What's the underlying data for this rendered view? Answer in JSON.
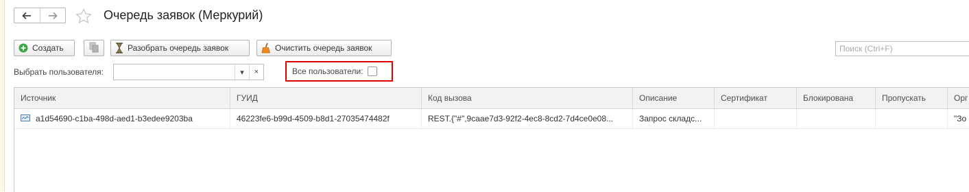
{
  "nav": {
    "back_icon": "arrow-left-icon",
    "forward_icon": "arrow-right-icon"
  },
  "favorite_icon": "star-icon",
  "title": "Очередь заявок (Меркурий)",
  "toolbar": {
    "create_label": "Создать",
    "create_icon": "plus-circle-icon",
    "copy_icon": "copy-icon",
    "parse_label": "Разобрать очередь заявок",
    "parse_icon": "hourglass-icon",
    "clear_label": "Очистить очередь заявок",
    "clear_icon": "broom-icon"
  },
  "search": {
    "placeholder": "Поиск (Ctrl+F)",
    "value": ""
  },
  "filter": {
    "user_label": "Выбрать пользователя:",
    "user_value": "",
    "dropdown_glyph": "▾",
    "clear_glyph": "×",
    "all_users_label": "Все пользователи:",
    "all_users_checked": false
  },
  "colors": {
    "highlight": "#e00000",
    "create_green": "#3aa847",
    "header_bg": "#f2f2f2"
  },
  "table": {
    "columns": [
      "Источник",
      "ГУИД",
      "Код вызова",
      "Описание",
      "Сертификат",
      "Блокирована",
      "Пропускать",
      "Орг"
    ],
    "rows": [
      {
        "icon": "document-row-icon",
        "cells": [
          "a1d54690-c1ba-498d-aed1-b3edee9203ba",
          "46223fe6-b99d-4509-b8d1-27035474482f",
          "REST.{\"#\",9caae7d3-92f2-4ec8-8cd2-7d4ce0e08...",
          "Запрос складс...",
          "",
          "",
          "",
          "\"Зо"
        ]
      }
    ]
  }
}
